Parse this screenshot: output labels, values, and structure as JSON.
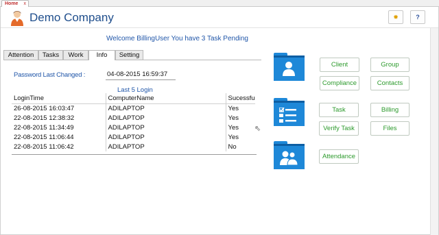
{
  "window": {
    "tab_label": "Home",
    "close_glyph": "x"
  },
  "header": {
    "company_name": "Demo Company",
    "logo_icon": "user-avatar-icon",
    "settings_icon": "sun-icon",
    "help_label": "?"
  },
  "welcome_text": "Welcome BillingUser You have 3 Task Pending",
  "tabs": [
    {
      "label": "Attention",
      "active": false
    },
    {
      "label": "Tasks",
      "active": false
    },
    {
      "label": "Work",
      "active": false
    },
    {
      "label": "Info",
      "active": true
    },
    {
      "label": "Setting",
      "active": false
    }
  ],
  "info": {
    "password_label": "Password Last Changed :",
    "password_value": "04-08-2015 16:59:37",
    "logins_title": "Last 5 Login",
    "columns": [
      "LoginTime",
      "ComputerName",
      "Sucessfu"
    ],
    "rows": [
      [
        "26-08-2015 16:03:47",
        "ADILAPTOP",
        "Yes"
      ],
      [
        "22-08-2015 12:38:32",
        "ADILAPTOP",
        "Yes"
      ],
      [
        "22-08-2015 11:34:49",
        "ADILAPTOP",
        "Yes"
      ],
      [
        "22-08-2015 11:06:44",
        "ADILAPTOP",
        "Yes"
      ],
      [
        "22-08-2015 11:06:42",
        "ADILAPTOP",
        "No"
      ]
    ]
  },
  "actions": {
    "client": "Client",
    "group": "Group",
    "compliance": "Compliance",
    "contacts": "Contacts",
    "task": "Task",
    "billing": "Billing",
    "verify_task": "Verify Task",
    "files": "Files",
    "attendance": "Attendance"
  },
  "colors": {
    "accent_blue": "#1e88d8",
    "button_text_green": "#2c9a2c",
    "title_blue": "#1f4e8c"
  }
}
